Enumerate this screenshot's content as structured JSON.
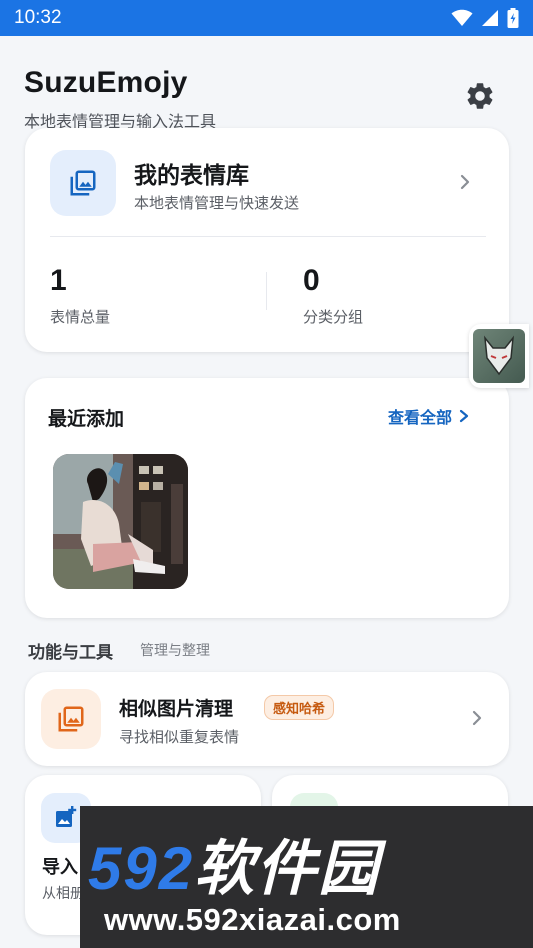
{
  "status_bar": {
    "time": "10:32"
  },
  "header": {
    "title": "SuzuEmojy",
    "subtitle": "本地表情管理与输入法工具"
  },
  "library": {
    "title": "我的表情库",
    "subtitle": "本地表情管理与快速发送",
    "stats": [
      {
        "value": "1",
        "label": "表情总量"
      },
      {
        "value": "0",
        "label": "分类分组"
      }
    ]
  },
  "recent": {
    "title": "最近添加",
    "view_all": "查看全部"
  },
  "tools": {
    "title": "功能与工具",
    "subtitle": "管理与整理",
    "similar": {
      "title": "相似图片清理",
      "badge": "感知哈希",
      "subtitle": "寻找相似重复表情"
    },
    "import": {
      "title": "导入",
      "subtitle": "从相册"
    }
  },
  "watermark": {
    "brand_num": "592",
    "brand_cn": "软件园",
    "url": "www.592xiazai.com"
  },
  "colors": {
    "accent": "#1b74e4",
    "link": "#1565c0",
    "badge": "#c65a10"
  },
  "icons": [
    "wifi-icon",
    "signal-icon",
    "battery-icon",
    "settings-gear-icon",
    "photo-library-icon",
    "chevron-right-icon",
    "image-copy-icon",
    "add-photo-icon"
  ]
}
